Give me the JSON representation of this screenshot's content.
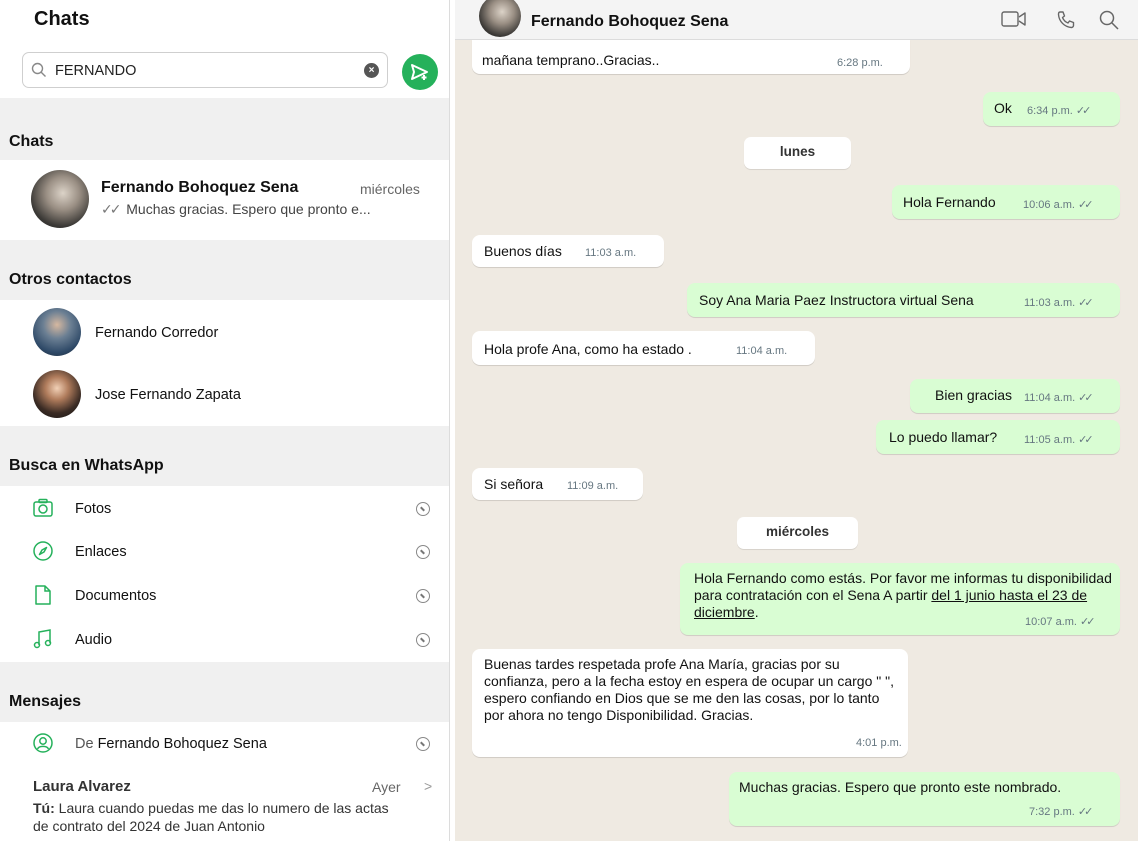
{
  "sidebar": {
    "title": "Chats",
    "search_value": "FERNANDO",
    "sections": {
      "chats": "Chats",
      "other_contacts": "Otros contactos",
      "search_whatsapp": "Busca en WhatsApp",
      "messages": "Mensajes"
    },
    "chat_result": {
      "name": "Fernando Bohoquez Sena",
      "time": "miércoles",
      "preview": "Muchas gracias. Espero que pronto e..."
    },
    "contacts": [
      {
        "name": "Fernando Corredor"
      },
      {
        "name": "Jose Fernando Zapata"
      }
    ],
    "wa_search_items": [
      {
        "label": "Fotos",
        "icon": "camera-icon"
      },
      {
        "label": "Enlaces",
        "icon": "compass-icon"
      },
      {
        "label": "Documentos",
        "icon": "document-icon"
      },
      {
        "label": "Audio",
        "icon": "music-note-icon"
      }
    ],
    "messages_filter": {
      "prefix": "De",
      "name": "Fernando Bohoquez Sena"
    },
    "message_result": {
      "name": "Laura Alvarez",
      "time": "Ayer",
      "sender": "Tú:",
      "text": "Laura cuando puedas me das lo numero de las actas de contrato del 2024 de Juan Antonio"
    }
  },
  "chat": {
    "contact_name": "Fernando Bohoquez Sena",
    "messages": [
      {
        "dir": "in",
        "text": "mañana temprano..Gracias..",
        "time": "6:28 p.m."
      },
      {
        "dir": "out",
        "text": "Ok",
        "time": "6:34 p.m."
      },
      {
        "dir": "day",
        "text": "lunes"
      },
      {
        "dir": "out",
        "text": "Hola Fernando",
        "time": "10:06 a.m."
      },
      {
        "dir": "in",
        "text": "Buenos días",
        "time": "11:03 a.m."
      },
      {
        "dir": "out",
        "text": "Soy Ana Maria Paez Instructora virtual Sena",
        "time": "11:03 a.m."
      },
      {
        "dir": "in",
        "text": "Hola profe Ana, como ha estado .",
        "time": "11:04 a.m."
      },
      {
        "dir": "out",
        "text": "Bien gracias",
        "time": "11:04 a.m."
      },
      {
        "dir": "out",
        "text": "Lo puedo llamar?",
        "time": "11:05 a.m."
      },
      {
        "dir": "in",
        "text": "Si señora",
        "time": "11:09 a.m."
      },
      {
        "dir": "day",
        "text": "miércoles"
      },
      {
        "dir": "out",
        "text_a": "Hola Fernando como estás.  Por favor me informas tu disponibilidad para contratación con el Sena A partir ",
        "text_link": "del 1 junio hasta el 23 de diciembre",
        "text_b": ".",
        "time": "10:07 a.m."
      },
      {
        "dir": "in",
        "text": "Buenas tardes respetada profe Ana María, gracias por su confianza, pero a la fecha estoy en espera de ocupar un cargo \" \", espero confiando en Dios que se me den las cosas, por lo tanto por ahora no tengo Disponibilidad. Gracias.",
        "time": "4:01 p.m."
      },
      {
        "dir": "out",
        "text": "Muchas gracias. Espero que pronto este nombrado.",
        "time": "7:32 p.m."
      }
    ]
  },
  "colors": {
    "accent": "#25b15b",
    "bubble_out": "#d9fdd3",
    "bubble_in": "#ffffff",
    "chat_bg": "#efeae2"
  }
}
